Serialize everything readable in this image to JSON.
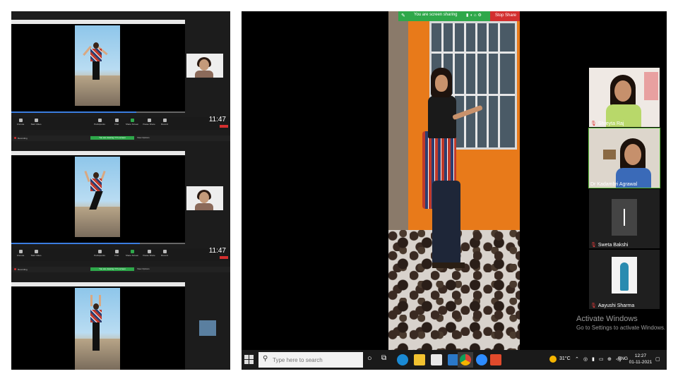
{
  "left_collage": {
    "panels": [
      {
        "clock": "11:47",
        "title": "",
        "end_label": ""
      },
      {
        "clock": "11:47",
        "title": "",
        "end_label": ""
      },
      {
        "clock": "",
        "title": "",
        "end_label": ""
      }
    ],
    "toolbar_items": [
      "Unmute",
      "Start Video",
      "Participants",
      "Chat",
      "Share Screen",
      "Pause Share",
      "Record"
    ],
    "share_bar": {
      "recording": "Recording",
      "pill": "You are viewing YY's screen",
      "options": "View Options"
    }
  },
  "zoom": {
    "share_banner": "You are screen sharing",
    "stop_share": "Stop Share",
    "participants": [
      {
        "name": "Shreyta Raj",
        "muted": true
      },
      {
        "name": "Dr Kadambri Agrawal",
        "muted": false
      },
      {
        "name": "Sweta Bakshi",
        "muted": true
      },
      {
        "name": "Aayushi Sharma",
        "muted": true
      }
    ],
    "watermark": {
      "line1": "Activate Windows",
      "line2": "Go to Settings to activate Windows."
    }
  },
  "taskbar": {
    "search_placeholder": "Type here to search",
    "weather": "31°C",
    "language": "ENG",
    "time": "12:27",
    "date": "01-11-2021",
    "icons": [
      "windows-icon",
      "search-icon",
      "task-view-icon",
      "edge-icon",
      "explorer-icon",
      "store-icon",
      "mail-icon",
      "chrome-icon",
      "zoom-icon",
      "office-icon"
    ]
  },
  "colors": {
    "share_green": "#2ea84a",
    "stop_red": "#d32f2f",
    "active_border": "#5fbf3f"
  }
}
